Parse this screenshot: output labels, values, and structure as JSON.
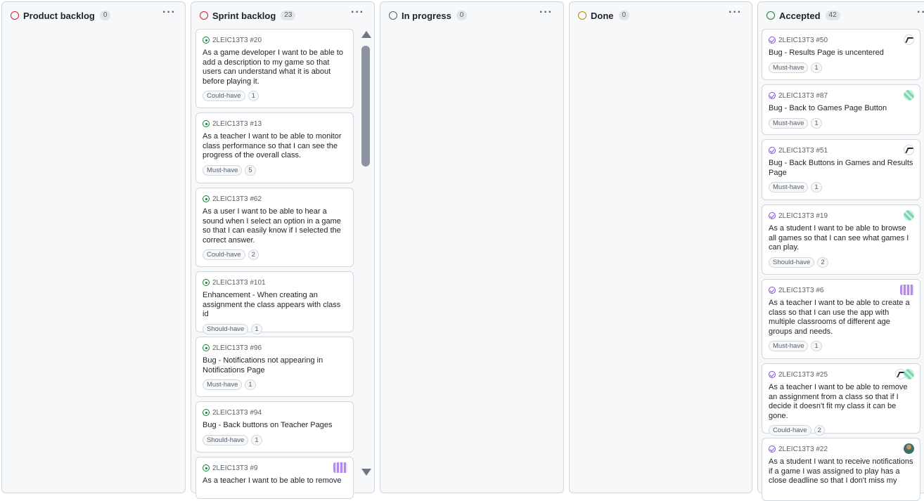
{
  "columns": {
    "product_backlog": {
      "title": "Product backlog",
      "count": "0",
      "menu": "···",
      "status_color": "#cf222e"
    },
    "sprint_backlog": {
      "title": "Sprint backlog",
      "count": "23",
      "menu": "···",
      "status_color": "#cf222e"
    },
    "in_progress": {
      "title": "In progress",
      "count": "0",
      "menu": "···",
      "status_color": "#57606a"
    },
    "done": {
      "title": "Done",
      "count": "0",
      "menu": "···",
      "status_color": "#bf8700"
    },
    "accepted": {
      "title": "Accepted",
      "count": "42",
      "menu": "···",
      "status_color": "#1a7f37"
    }
  },
  "sprint_cards": [
    {
      "ref": "2LEIC13T3 #20",
      "title": "As a game developer I want to be able to add a description to my game so that users can understand what it is about before playing it.",
      "label": "Could-have",
      "points": "1"
    },
    {
      "ref": "2LEIC13T3 #13",
      "title": "As a teacher I want to be able to monitor class performance so that I can see the progress of the overall class.",
      "label": "Must-have",
      "points": "5"
    },
    {
      "ref": "2LEIC13T3 #62",
      "title": "As a user I want to be able to hear a sound when I select an option in a game so that I can easily know if I selected the correct answer.",
      "label": "Could-have",
      "points": "2"
    },
    {
      "ref": "2LEIC13T3 #101",
      "title": "Enhancement - When creating an assignment the class appears with class id",
      "label": "Should-have",
      "points": "1"
    },
    {
      "ref": "2LEIC13T3 #96",
      "title": "Bug - Notifications not appearing in Notifications Page",
      "label": "Must-have",
      "points": "1"
    },
    {
      "ref": "2LEIC13T3 #94",
      "title": "Bug - Back buttons on Teacher Pages",
      "label": "Should-have",
      "points": "1"
    },
    {
      "ref": "2LEIC13T3 #9",
      "title": "As a teacher I want to be able to remove"
    }
  ],
  "accepted_cards": [
    {
      "ref": "2LEIC13T3 #50",
      "title": "Bug - Results Page is uncentered",
      "label": "Must-have",
      "points": "1",
      "avatar": "pen-avatar"
    },
    {
      "ref": "2LEIC13T3 #87",
      "title": "Bug - Back to Games Page Button",
      "label": "Must-have",
      "points": "1",
      "avatar": "green-pattern-avatar"
    },
    {
      "ref": "2LEIC13T3 #51",
      "title": "Bug - Back Buttons in Games and Results Page",
      "label": "Must-have",
      "points": "1",
      "avatar": "pen-avatar"
    },
    {
      "ref": "2LEIC13T3 #19",
      "title": "As a student I want to be able to browse all games so that I can see what games I can play.",
      "label": "Should-have",
      "points": "2",
      "avatar": "green-pattern-avatar"
    },
    {
      "ref": "2LEIC13T3 #6",
      "title": "As a teacher I want to be able to create a class so that I can use the app with multiple classrooms of different age groups and needs.",
      "label": "Must-have",
      "points": "1",
      "avatar": "purple-pattern-avatar"
    },
    {
      "ref": "2LEIC13T3 #25",
      "title": "As a teacher I want to be able to remove an assignment from a class so that if I decide it doesn't fit my class it can be gone.",
      "label": "Could-have",
      "points": "2",
      "avatar": "pen-and-green-avatars"
    },
    {
      "ref": "2LEIC13T3 #22",
      "title": "As a student I want to receive notifications if a game I was assigned to play has a close deadline so that I don't miss my",
      "avatar": "person-avatar"
    }
  ],
  "colors": {
    "open_issue": "#1a7f37",
    "closed_issue": "#8250df",
    "border": "#d0d7de"
  }
}
